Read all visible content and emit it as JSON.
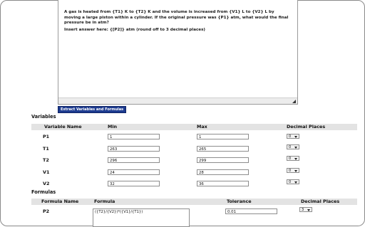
{
  "question": {
    "text": "A gas is heated from {T1} K to {T2} K and the volume is increased from {V1} L to {V2} L by moving a large piston within a cylinder. If the original pressure was {P1} atm, what would the final pressure be in atm?",
    "answer_prompt": "Insert answer here: {[P2]} atm (round off to 3 decimal places)"
  },
  "extract_button": "Extract Variables and Formulas",
  "variables": {
    "title": "Variables",
    "headers": [
      "Variable Name",
      "Min",
      "Max",
      "Decimal Places"
    ],
    "rows": [
      {
        "name": "P1",
        "min": "1",
        "max": "1",
        "decimals": "0"
      },
      {
        "name": "T1",
        "min": "263",
        "max": "265",
        "decimals": "0"
      },
      {
        "name": "T2",
        "min": "296",
        "max": "299",
        "decimals": "0"
      },
      {
        "name": "V1",
        "min": "24",
        "max": "28",
        "decimals": "0"
      },
      {
        "name": "V2",
        "min": "32",
        "max": "36",
        "decimals": "0"
      }
    ]
  },
  "formulas": {
    "title": "Formulas",
    "headers": [
      "Formula Name",
      "Formula",
      "Tolerance",
      "Decimal Places"
    ],
    "rows": [
      {
        "name": "P2",
        "formula": "({T2}/{V2})*({V1}/{T1})",
        "tolerance": "0.01",
        "decimals": "3"
      }
    ]
  }
}
